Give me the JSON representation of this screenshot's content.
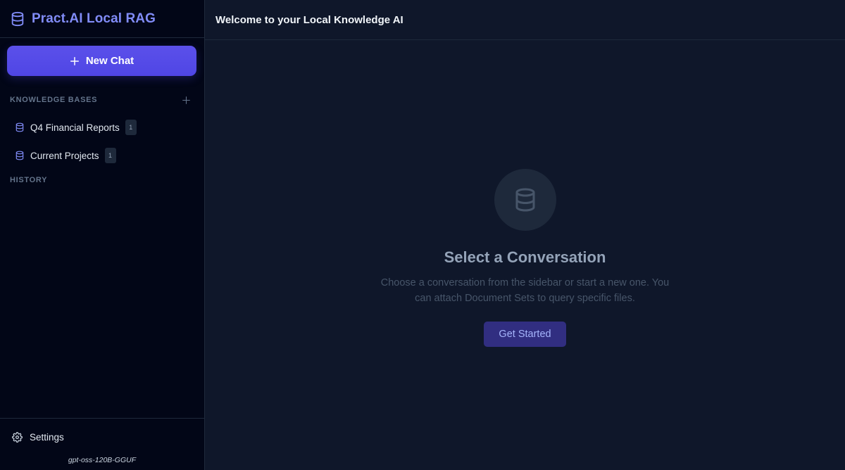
{
  "brand": {
    "title": "Pract.AI Local RAG",
    "icon": "database-icon",
    "color": "#818cf8"
  },
  "sidebar": {
    "new_chat_label": "New Chat",
    "knowledge_bases": {
      "heading": "KNOWLEDGE BASES",
      "items": [
        {
          "label": "Q4 Financial Reports",
          "count": "1"
        },
        {
          "label": "Current Projects",
          "count": "1"
        }
      ]
    },
    "history": {
      "heading": "HISTORY"
    },
    "settings_label": "Settings",
    "model_name": "gpt-oss-120B-GGUF"
  },
  "main": {
    "title": "Welcome to your Local Knowledge AI",
    "empty_state": {
      "icon": "database-icon",
      "title": "Select a Conversation",
      "description": "Choose a conversation from the sidebar or start a new one. You can attach Document Sets to query specific files.",
      "button_label": "Get Started"
    }
  },
  "colors": {
    "accent": "#4f46e5",
    "sidebar_bg": "#020617",
    "main_bg": "#0f172a"
  }
}
